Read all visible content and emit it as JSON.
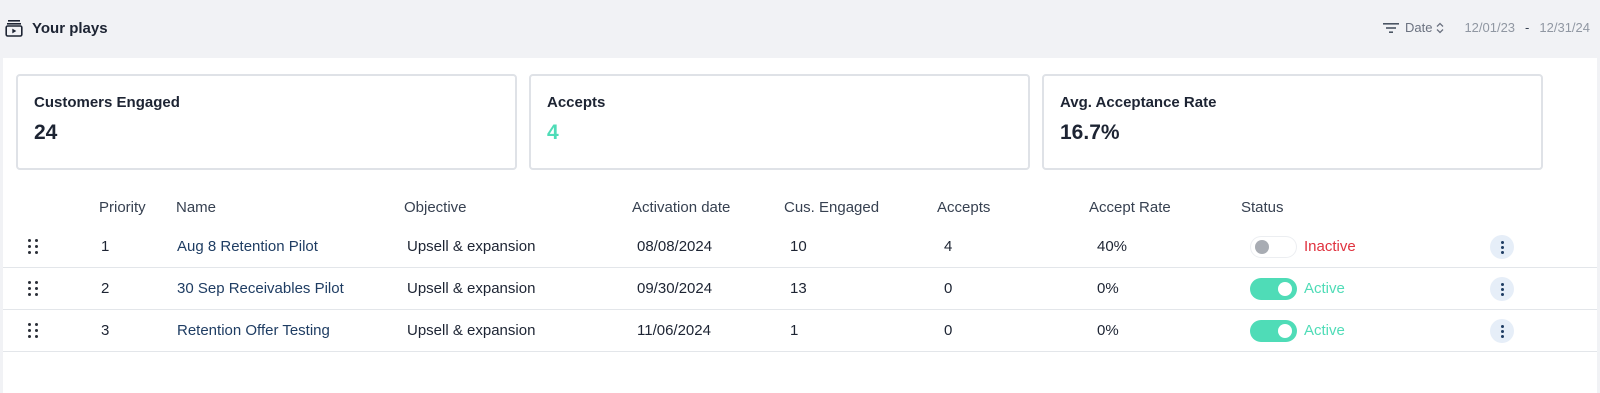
{
  "header": {
    "title": "Your plays",
    "icon": "play-folder-icon",
    "filter_icon": "filter-lines-icon",
    "sort_label": "Date",
    "sort_icon": "sort-updown-icon",
    "date_from": "12/01/23",
    "date_separator": "-",
    "date_to": "12/31/24"
  },
  "cards": [
    {
      "label": "Customers Engaged",
      "value": "24"
    },
    {
      "label": "Accepts",
      "value": "4",
      "value_color": "#4fdcb7"
    },
    {
      "label": "Avg. Acceptance Rate",
      "value": "16.7%"
    }
  ],
  "table": {
    "columns": [
      "Priority",
      "Name",
      "Objective",
      "Activation date",
      "Cus. Engaged",
      "Accepts",
      "Accept Rate",
      "Status"
    ],
    "rows": [
      {
        "priority": "1",
        "name": "Aug 8 Retention Pilot",
        "objective": "Upsell & expansion",
        "activation_date": "08/08/2024",
        "engaged": "10",
        "accepts": "4",
        "rate": "40%",
        "status": "Inactive",
        "enabled": false
      },
      {
        "priority": "2",
        "name": "30 Sep Receivables Pilot",
        "objective": "Upsell & expansion",
        "activation_date": "09/30/2024",
        "engaged": "13",
        "accepts": "0",
        "rate": "0%",
        "status": "Active",
        "enabled": true
      },
      {
        "priority": "3",
        "name": "Retention Offer Testing",
        "objective": "Upsell & expansion",
        "activation_date": "11/06/2024",
        "engaged": "1",
        "accepts": "0",
        "rate": "0%",
        "status": "Active",
        "enabled": true
      }
    ]
  },
  "colors": {
    "active": "#4fdcb7",
    "inactive": "#e0323f",
    "link": "#1f3d63"
  }
}
